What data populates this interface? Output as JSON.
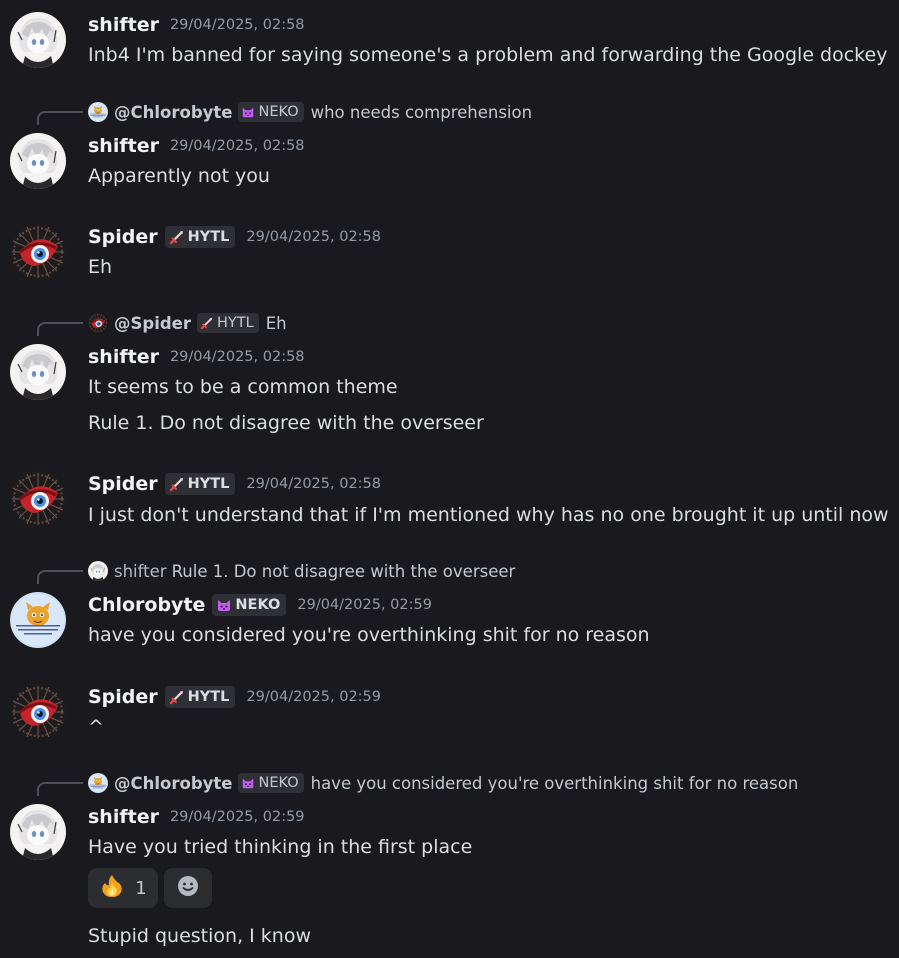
{
  "users": {
    "shifter": "shifter",
    "spider": "Spider",
    "chlorobyte": "Chlorobyte"
  },
  "tags": {
    "neko": "NEKO",
    "hytl": "HYTL"
  },
  "messages": [
    {
      "author": "shifter",
      "time": "29/04/2025, 02:58",
      "text": "Inb4 I'm banned for saying someone's a problem and forwarding the Google dockey"
    },
    {
      "reply": {
        "author": "@Chlorobyte",
        "tag": "NEKO",
        "text": "who needs comprehension"
      },
      "author": "shifter",
      "time": "29/04/2025, 02:58",
      "text": "Apparently not you"
    },
    {
      "author": "Spider",
      "tag": "HYTL",
      "time": "29/04/2025, 02:58",
      "text": "Eh"
    },
    {
      "reply": {
        "author": "@Spider",
        "tag": "HYTL",
        "text": "Eh"
      },
      "author": "shifter",
      "time": "29/04/2025, 02:58",
      "text": "It seems to be a common theme",
      "followup": "Rule 1. Do not disagree with the overseer"
    },
    {
      "author": "Spider",
      "tag": "HYTL",
      "time": "29/04/2025, 02:58",
      "text": "I just don't understand that if I'm mentioned why has no one brought it up until now"
    },
    {
      "reply": {
        "author": "shifter",
        "text": "Rule 1. Do not disagree with the overseer"
      },
      "author": "Chlorobyte",
      "tag": "NEKO",
      "time": "29/04/2025, 02:59",
      "text": "have you considered you're overthinking shit for no reason"
    },
    {
      "author": "Spider",
      "tag": "HYTL",
      "time": "29/04/2025, 02:59",
      "text": "^"
    },
    {
      "reply": {
        "author": "@Chlorobyte",
        "tag": "NEKO",
        "text": "have you considered you're overthinking shit for no reason"
      },
      "author": "shifter",
      "time": "29/04/2025, 02:59",
      "text": "Have you tried thinking in the first place",
      "reaction": {
        "emoji": "fire-icon",
        "count": "1"
      },
      "followup": "Stupid question, I know"
    }
  ],
  "icons": {
    "sword": "sword-icon",
    "cat": "cat-icon",
    "fire": "fire-icon",
    "add_reaction": "add-reaction-icon"
  },
  "colors": {
    "background": "#1a1a1e",
    "username": "#f2f3f5",
    "text": "#dbdee1",
    "timestamp": "#949ba4",
    "tag_bg": "#2f3036",
    "neko_icon": "#c45cf0",
    "hytl_icon": "#e04848"
  }
}
